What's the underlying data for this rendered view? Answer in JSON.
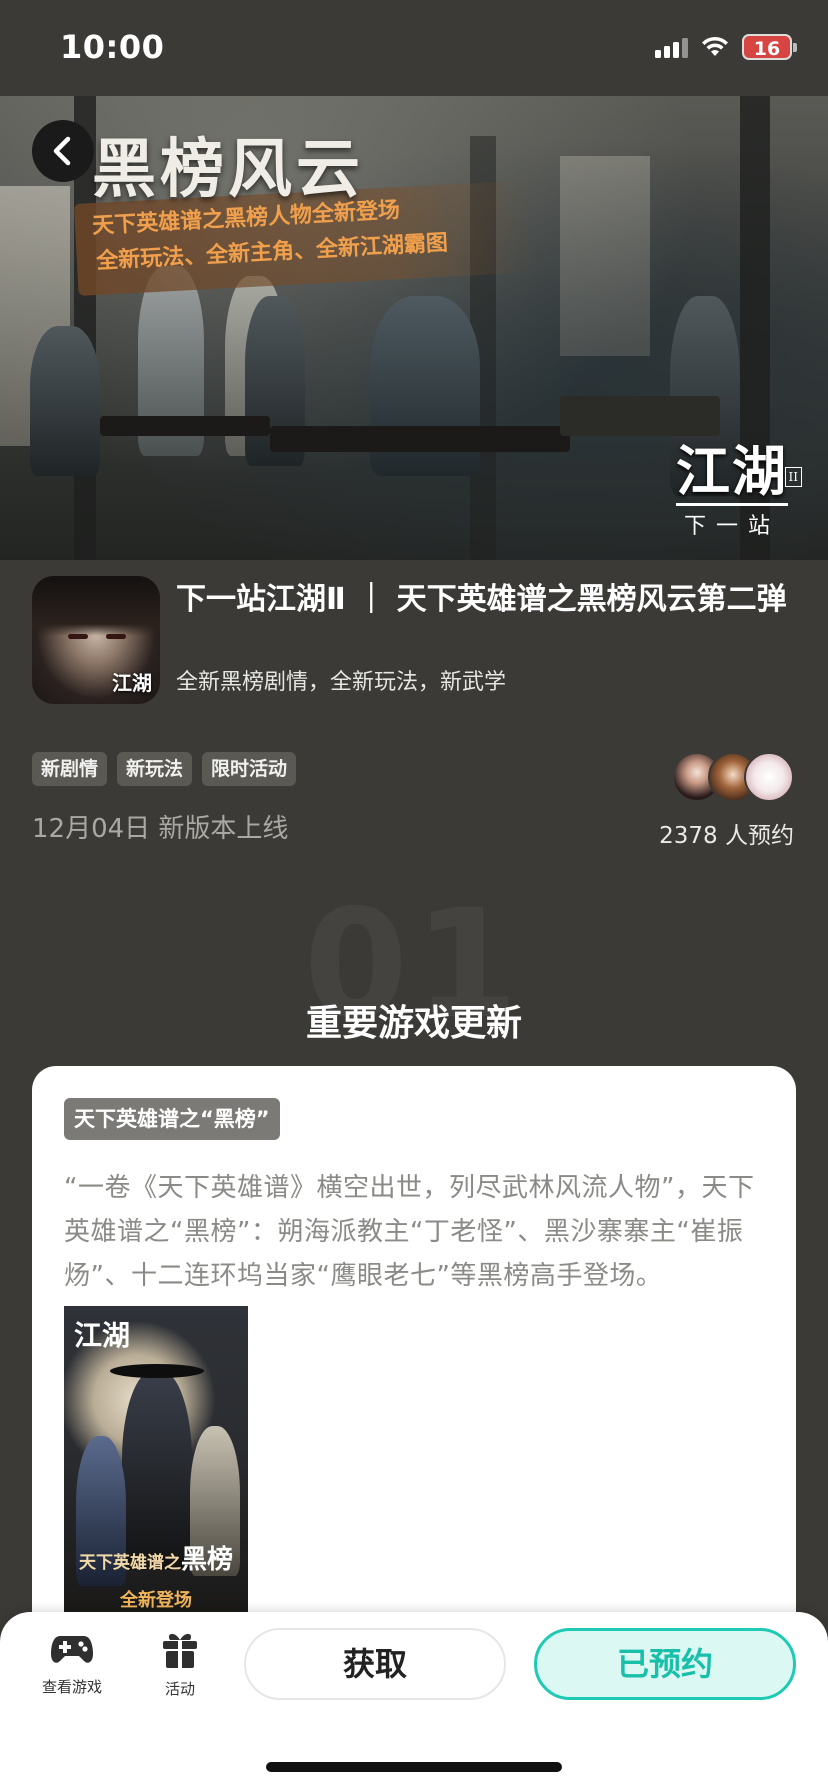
{
  "status_bar": {
    "time": "10:00",
    "battery": "16"
  },
  "banner": {
    "title": "黑榜风云",
    "subtitle_line1": "天下英雄谱之黑榜人物全新登场",
    "subtitle_line2": "全新玩法、全新主角、全新江湖霸图",
    "logo_main": "江湖",
    "logo_sub": "下一站",
    "logo_badge": "II"
  },
  "app": {
    "icon_logo": "江湖",
    "title": "下一站江湖Ⅱ ｜ 天下英雄谱之黑榜风云第二弹",
    "description": "全新黑榜剧情，全新玩法，新武学",
    "tags": [
      "新剧情",
      "新玩法",
      "限时活动"
    ],
    "launch_date": "12月04日 新版本上线",
    "reservations": "2378 人预约"
  },
  "section": {
    "number": "01",
    "title": "重要游戏更新"
  },
  "card": {
    "tag": "天下英雄谱之“黑榜”",
    "text": "“一卷《天下英雄谱》横空出世，列尽武林风流人物”，天下英雄谱之“黑榜”：朔海派教主“丁老怪”、黑沙寨寨主“崔振炀”、十二连环坞当家“鹰眼老七”等黑榜高手登场。",
    "poster": {
      "logo": "江湖",
      "line1_prefix": "天下英雄谱之",
      "line1_big": "黑榜",
      "line2": "全新登场"
    }
  },
  "bottom_bar": {
    "view_game": "查看游戏",
    "activity": "活动",
    "get_button": "获取",
    "reserved_button": "已预约"
  },
  "colors": {
    "background": "#3b3a36",
    "accent": "#1fcab4",
    "battery_low": "#d64541"
  }
}
